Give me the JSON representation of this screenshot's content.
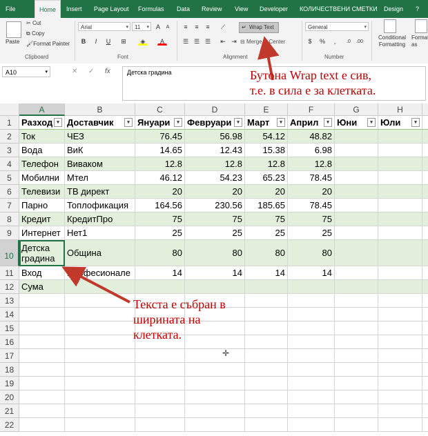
{
  "ribbon_tabs": [
    "File",
    "Home",
    "Insert",
    "Page Layout",
    "Formulas",
    "Data",
    "Review",
    "View",
    "Developer",
    "КОЛИЧЕСТВЕНИ СМЕТКИ",
    "Design",
    "?"
  ],
  "ribbon": {
    "paste": "Paste",
    "cut": "Cut",
    "copy": "Copy",
    "format_painter": "Format Painter",
    "clipboard": "Clipboard",
    "font_name": "Arial",
    "font_size": "11",
    "bold": "B",
    "italic": "I",
    "underline": "U",
    "font_group": "Font",
    "wrap_text": "Wrap Text",
    "merge_center": "Merge & Center",
    "alignment": "Alignment",
    "number_format": "General",
    "number_group": "Number",
    "conditional_formatting": "Conditional Formatting",
    "format_as_table": "Format as Table"
  },
  "formula_bar": {
    "name_box": "A10",
    "formula": "Детска градина",
    "cancel": "✕",
    "enter": "✓",
    "fx": "fx"
  },
  "columns": [
    "A",
    "B",
    "C",
    "D",
    "E",
    "F",
    "G",
    "H",
    "I"
  ],
  "rows": [
    "1",
    "2",
    "3",
    "4",
    "5",
    "6",
    "7",
    "8",
    "9",
    "10",
    "11",
    "12",
    "13",
    "14",
    "15",
    "16",
    "17",
    "18",
    "19",
    "20",
    "21",
    "22"
  ],
  "table": {
    "header": [
      "Разход",
      "Доставчик",
      "Януари",
      "Февруари",
      "Март",
      "Април",
      "Юни",
      "Юли",
      ""
    ],
    "body": [
      [
        "Ток",
        "ЧЕЗ",
        "76.45",
        "56.98",
        "54.12",
        "48.82"
      ],
      [
        "Вода",
        "ВиК",
        "14.65",
        "12.43",
        "15.38",
        "6.98"
      ],
      [
        "Телефон",
        "Виваком",
        "12.8",
        "12.8",
        "12.8",
        "12.8"
      ],
      [
        "Мобилни",
        "Мтел",
        "46.12",
        "54.23",
        "65.23",
        "78.45"
      ],
      [
        "Телевизи",
        "ТВ директ",
        "20",
        "20",
        "20",
        "20"
      ],
      [
        "Парно",
        "Топлофикация",
        "164.56",
        "230.56",
        "185.65",
        "78.45"
      ],
      [
        "Кредит",
        "КредитПро",
        "75",
        "75",
        "75",
        "75"
      ],
      [
        "Интернет",
        "Нет1",
        "25",
        "25",
        "25",
        "25"
      ],
      [
        "Детска градина",
        "Община",
        "80",
        "80",
        "80",
        "80"
      ],
      [
        "Вход",
        "Професионале",
        "14",
        "14",
        "14",
        "14"
      ],
      [
        "Сума",
        "",
        "",
        "",
        "",
        ""
      ]
    ]
  },
  "annotations": {
    "top_line1": "Бутона Wrap text е сив,",
    "top_line2": "т.е. в сила е за клетката.",
    "bottom_line1": "Текста е събран в",
    "bottom_line2": "ширината на",
    "bottom_line3": "клетката."
  },
  "colors": {
    "accent": "#217346",
    "band": "#e2efda",
    "annotation": "#c00000"
  }
}
